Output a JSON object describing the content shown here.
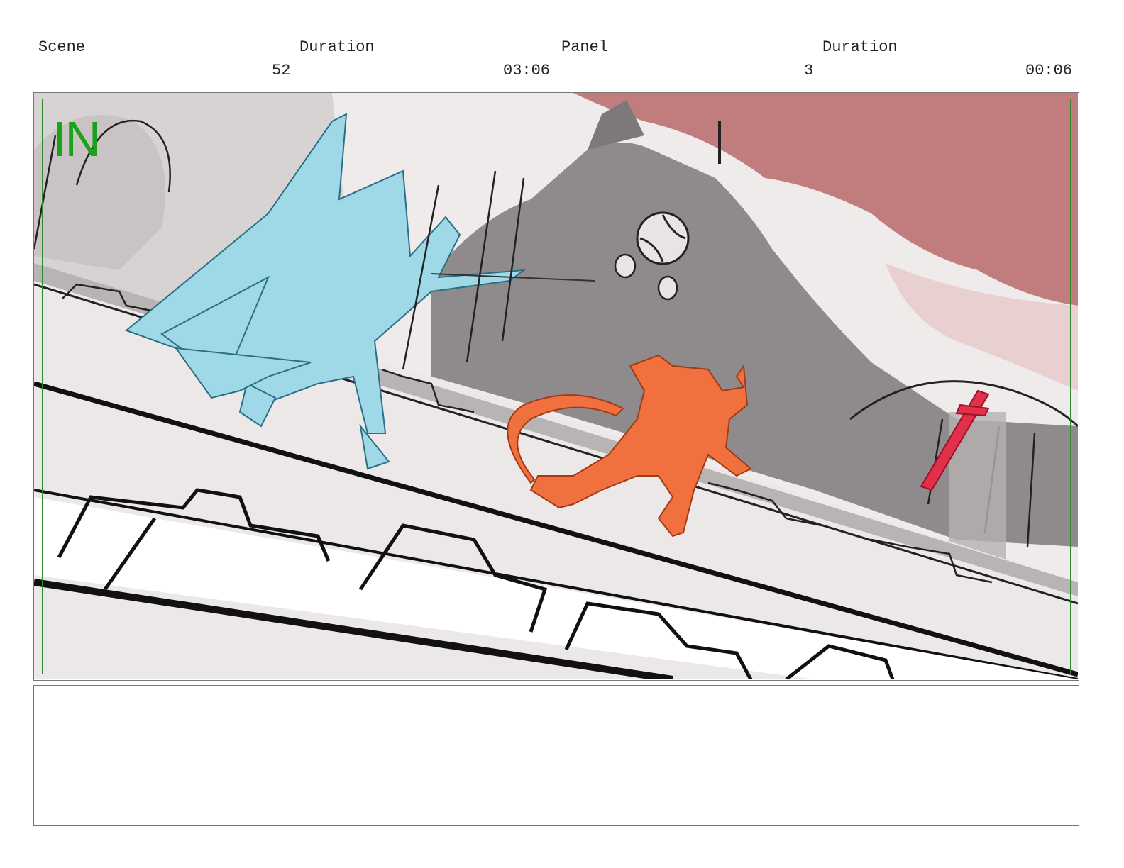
{
  "header": {
    "scene_label": "Scene",
    "scene_duration_label": "Duration",
    "panel_label": "Panel",
    "panel_duration_label": "Duration",
    "scene_number": "52",
    "scene_duration": "03:06",
    "panel_number": "3",
    "panel_duration": "00:06"
  },
  "panel": {
    "transition_marker": "IN",
    "marker_color": "#1aa31a",
    "colors": {
      "sky": "#c17d7e",
      "cathedral": "#8f8a8b",
      "blue_figure": "#9fd8e6",
      "orange_figure": "#f0703f",
      "red_sword": "#e0304a",
      "safe_frame": "#2e8b2e"
    }
  },
  "notes": {
    "text": ""
  }
}
